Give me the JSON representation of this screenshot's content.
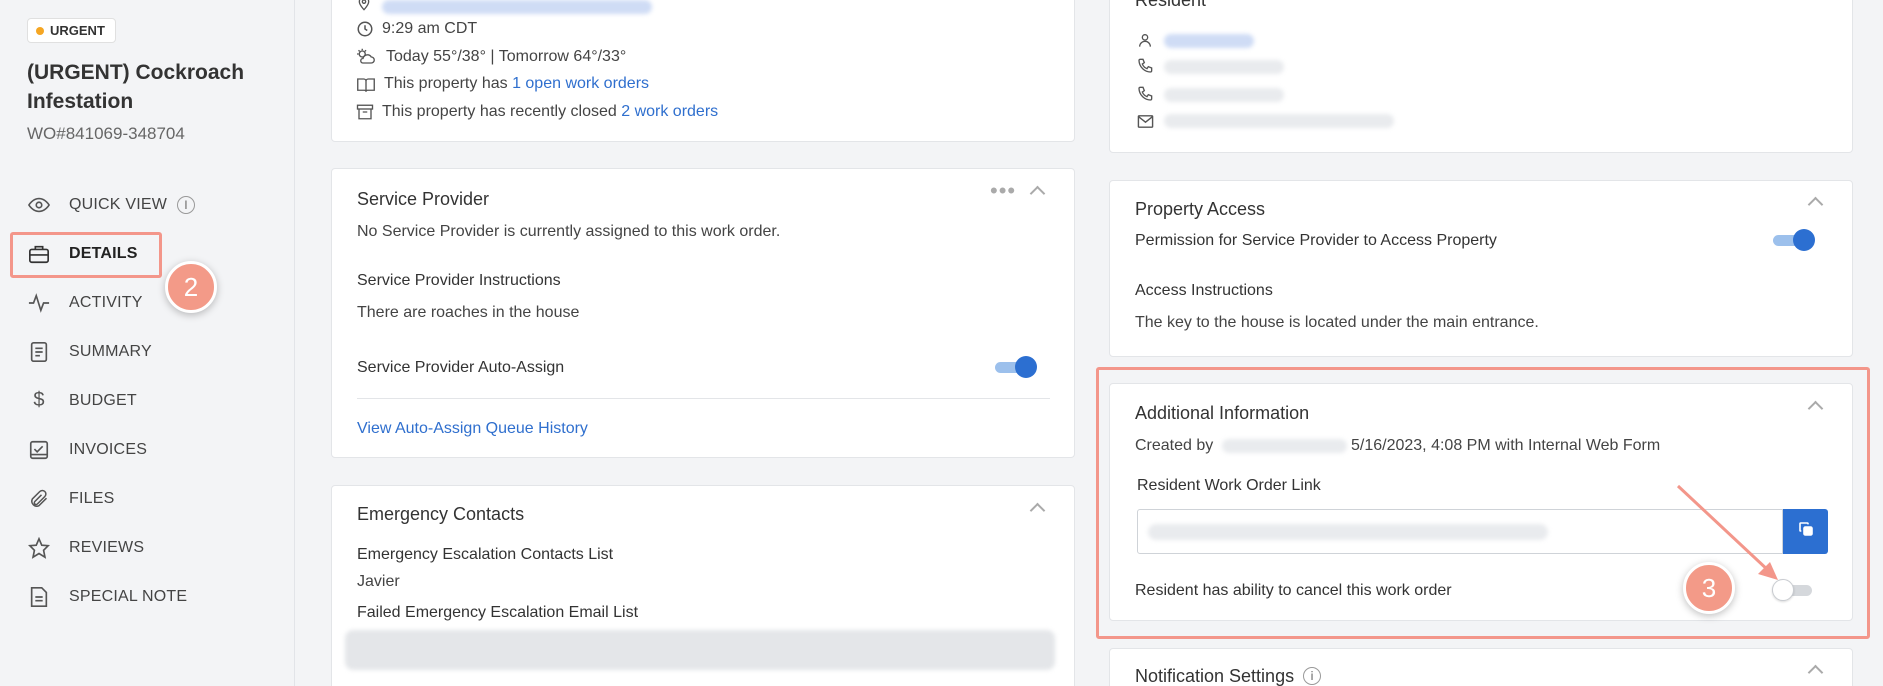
{
  "sidebar": {
    "badge": "URGENT",
    "title": "(URGENT) Cockroach Infestation",
    "wo_number": "WO#841069-348704",
    "nav": [
      {
        "label": "QUICK VIEW",
        "icon": "eye-icon"
      },
      {
        "label": "DETAILS",
        "icon": "briefcase-icon"
      },
      {
        "label": "ACTIVITY",
        "icon": "activity-pulse-icon"
      },
      {
        "label": "SUMMARY",
        "icon": "document-list-icon"
      },
      {
        "label": "BUDGET",
        "icon": "dollar-icon"
      },
      {
        "label": "INVOICES",
        "icon": "invoice-check-icon"
      },
      {
        "label": "FILES",
        "icon": "paperclip-icon"
      },
      {
        "label": "REVIEWS",
        "icon": "star-icon"
      },
      {
        "label": "SPECIAL NOTE",
        "icon": "note-icon"
      }
    ]
  },
  "property": {
    "time": "9:29 am CDT",
    "weather": "Today 55°/38° | Tomorrow 64°/33°",
    "open_prefix": "This property has ",
    "open_link": "1 open work orders",
    "closed_prefix": "This property has recently closed ",
    "closed_link": "2 work orders"
  },
  "service_provider": {
    "title": "Service Provider",
    "none_text": "No Service Provider is currently assigned to this work order.",
    "instructions_label": "Service Provider Instructions",
    "instructions_text": "There are roaches in the house",
    "auto_assign_label": "Service Provider Auto-Assign",
    "auto_assign_on": true,
    "queue_link": "View Auto-Assign Queue History"
  },
  "emergency": {
    "title": "Emergency Contacts",
    "escalation_label": "Emergency Escalation Contacts List",
    "escalation_value": "Javier",
    "failed_label": "Failed Emergency Escalation Email List"
  },
  "resident": {
    "title": "Resident"
  },
  "property_access": {
    "title": "Property Access",
    "permission_label": "Permission for Service Provider to Access Property",
    "permission_on": true,
    "instructions_label": "Access Instructions",
    "instructions_text": "The key to the house is located under the main entrance."
  },
  "additional": {
    "title": "Additional Information",
    "created_prefix": "Created by",
    "created_suffix": "5/16/2023, 4:08 PM with Internal Web Form",
    "link_label": "Resident Work Order Link",
    "cancel_label": "Resident has ability to cancel this work order",
    "cancel_on": false
  },
  "notification": {
    "title": "Notification Settings"
  },
  "callouts": [
    "2",
    "3"
  ],
  "colors": {
    "accent": "#2c6fd1",
    "highlight": "#f3968a",
    "urgent_dot": "#f5a623"
  }
}
